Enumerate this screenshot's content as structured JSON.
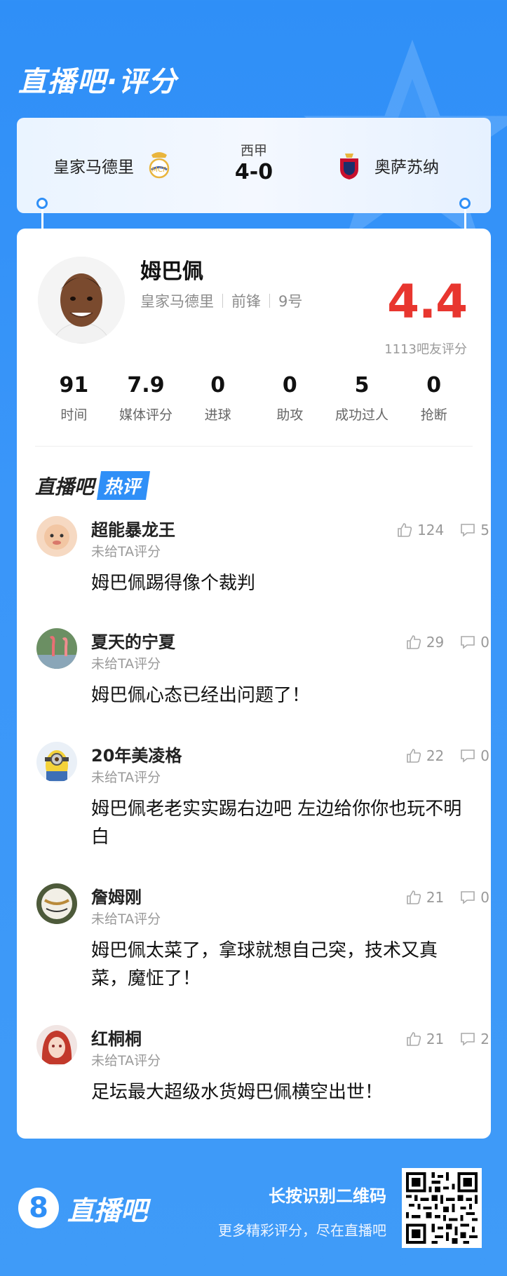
{
  "app_title": "直播吧·评分",
  "match": {
    "home_team": "皇家马德里",
    "league": "西甲",
    "score": "4-0",
    "away_team": "奥萨苏纳"
  },
  "player": {
    "name": "姆巴佩",
    "team": "皇家马德里",
    "position": "前锋",
    "number": "9号",
    "rating": "4.4",
    "rating_count": "1113吧友评分",
    "stats": [
      {
        "value": "91",
        "label": "时间"
      },
      {
        "value": "7.9",
        "label": "媒体评分"
      },
      {
        "value": "0",
        "label": "进球"
      },
      {
        "value": "0",
        "label": "助攻"
      },
      {
        "value": "5",
        "label": "成功过人"
      },
      {
        "value": "0",
        "label": "抢断"
      }
    ]
  },
  "hot": {
    "title_a": "直播吧",
    "title_b": "热评"
  },
  "comments": [
    {
      "name": "超能暴龙王",
      "sub": "未给TA评分",
      "text": "姆巴佩踢得像个裁判",
      "likes": "124",
      "replies": "5"
    },
    {
      "name": "夏天的宁夏",
      "sub": "未给TA评分",
      "text": "姆巴佩心态已经出问题了！",
      "likes": "29",
      "replies": "0"
    },
    {
      "name": "20年美凌格",
      "sub": "未给TA评分",
      "text": "姆巴佩老老实实踢右边吧 左边给你你也玩不明白",
      "likes": "22",
      "replies": "0"
    },
    {
      "name": "詹姆刚",
      "sub": "未给TA评分",
      "text": "姆巴佩太菜了，拿球就想自己突，技术又真菜，魔怔了！",
      "likes": "21",
      "replies": "0"
    },
    {
      "name": "红桐桐",
      "sub": "未给TA评分",
      "text": "足坛最大超级水货姆巴佩横空出世！",
      "likes": "21",
      "replies": "2"
    }
  ],
  "footer": {
    "logo_mark": "8",
    "logo_text": "直播吧",
    "qr_title": "长按识别二维码",
    "qr_sub": "更多精彩评分，尽在直播吧"
  },
  "colors": {
    "accent": "#2f8ff7",
    "rating": "#e8362f"
  }
}
